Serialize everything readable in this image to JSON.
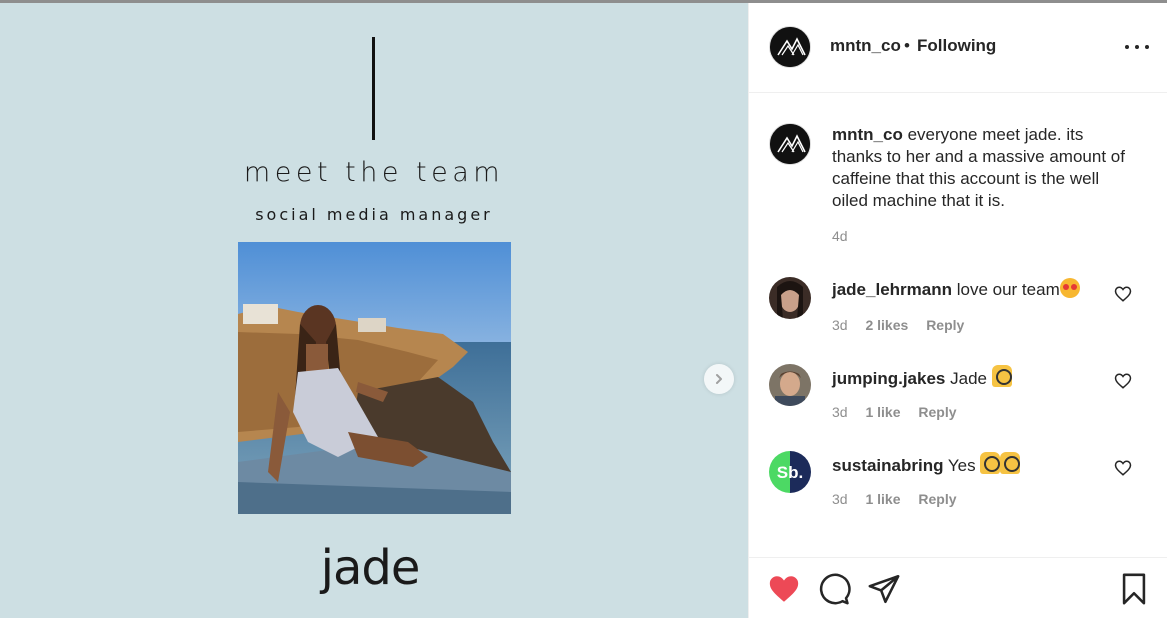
{
  "colors": {
    "media_bg": "#cddfe3",
    "like_red": "#ed4956",
    "muted": "#8e8e8e",
    "text": "#262626",
    "sb_green": "#4cd964",
    "sb_navy": "#1c2b5a"
  },
  "media": {
    "title": "meet the team",
    "subtitle": "social media manager",
    "name": "jade",
    "next_icon": "chevron-right-icon"
  },
  "post_header": {
    "username": "mntn_co",
    "separator": "•",
    "follow_status": "Following",
    "more_icon": "more-options-icon"
  },
  "caption": {
    "username": "mntn_co",
    "text": "everyone meet jade. its thanks to her and a massive amount of caffeine that this account is the well oiled machine that it is.",
    "time": "4d"
  },
  "comments": [
    {
      "username": "jade_lehrmann",
      "text": "love our team",
      "emoji": "smiling-face-with-hearts-emoji",
      "time": "3d",
      "likes": "2 likes",
      "reply": "Reply"
    },
    {
      "username": "jumping.jakes",
      "text": "Jade",
      "emoji": "raising-hands-emoji",
      "time": "3d",
      "likes": "1 like",
      "reply": "Reply"
    },
    {
      "username": "sustainabring",
      "text": "Yes",
      "emoji": "raising-hands-emoji x2",
      "avatar_text": "Sb.",
      "time": "3d",
      "likes": "1 like",
      "reply": "Reply"
    }
  ],
  "actions": {
    "like_icon": "heart-filled-icon",
    "comment_icon": "comment-icon",
    "share_icon": "share-icon",
    "save_icon": "bookmark-icon"
  }
}
